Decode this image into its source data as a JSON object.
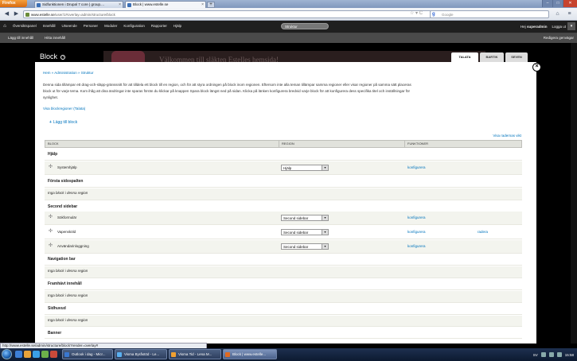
{
  "browser": {
    "app_button": "Firefox",
    "tabs": [
      {
        "label": "Sidfunktionen i Drupal 7 core | group....",
        "active": false
      },
      {
        "label": "Block | www.estelle.se",
        "active": true
      }
    ],
    "new_tab": "+",
    "url_prefix": "www.estelle.se",
    "url_rest": "/user/1#overlay=admin/structure/block",
    "search_engine": "Google",
    "search_placeholder": "Google",
    "status_url": "http://www.estelle.se/admin/structure/block?render=overlay#"
  },
  "toolbar": {
    "items": [
      "Översiktspanel",
      "Innehåll",
      "Struktur",
      "Utseende",
      "Personer",
      "Moduler",
      "Konfiguration",
      "Rapporter",
      "Hjälp"
    ],
    "selected": "Struktur",
    "greeting_prefix": "Hej",
    "username": "superadmin",
    "logout": "Logga ut",
    "shortcuts": [
      "Lägg till innehåll",
      "Hitta innehåll"
    ],
    "edit_shortcuts": "Redigera genvägar"
  },
  "background_site": {
    "welcome": "Välkommen till släkten Estelles hemsida!"
  },
  "overlay": {
    "title": "Block",
    "theme_tabs": [
      "TALATA",
      "BARTIK",
      "SEVEN"
    ],
    "active_theme": "TALATA",
    "breadcrumb": "Hem » Administration » Struktur",
    "description_1": "Denna sida tillämpar ett drag-och-släpp-gränssnitt för att tilldela ett block till en region, och för att styra ordningen på block inom regionen. Eftersom inte alla teman tillämpar samma regioner eller visar regioner på samma sätt placeras",
    "description_2": "block ut för varje tema. Kom ihåg att dina ändringar inte sparas förrän du klickar på knappen Spara block längst ned på sidan. Klicka på länken konfigurera bredvid varje block för att konfigurera dess specifika titel och inställningar för",
    "description_3": "synlighet.",
    "show_regions": "Visa blockregioner (Talata)",
    "add_block": "Lägg till block",
    "show_weights": "Visa radernas vikt",
    "columns": {
      "block": "BLOCK",
      "region": "REGION",
      "functions": "FUNKTIONER"
    },
    "regions": [
      {
        "name": "Hjälp",
        "blocks": [
          {
            "name": "Systemhjälp",
            "region": "Hjälp",
            "configure": "konfigurera"
          }
        ]
      },
      {
        "name": "Första sidospalten",
        "empty": "Inga block i denna region"
      },
      {
        "name": "Second sidebar",
        "blocks": [
          {
            "name": "Sökformulär",
            "region": "Second sidebar",
            "configure": "konfigurera"
          },
          {
            "name": "Vapensköld",
            "region": "Second sidebar",
            "configure": "konfigurera",
            "delete": "radera"
          },
          {
            "name": "Användarinloggning",
            "region": "Second sidebar",
            "configure": "konfigurera"
          }
        ]
      },
      {
        "name": "Navigation bar",
        "empty": "Inga block i denna region"
      },
      {
        "name": "Framhävt innehåll",
        "empty": "Inga block i denna region"
      },
      {
        "name": "Sidhuvud",
        "empty": "Inga block i denna region"
      },
      {
        "name": "Banner"
      }
    ]
  },
  "taskbar": {
    "tasks": [
      "Outlook i dag - Micr...",
      "Visma Byråstöd - Le...",
      "Visma Tid - Lena M...",
      "Block | www.estelle..."
    ],
    "active_task": "Block | www.estelle...",
    "language": "SV",
    "clock": "15:58"
  },
  "colors": {
    "link": "#0074bd",
    "toolbar_bg": "#1f1f1f",
    "header_bg": "#e1e2dc"
  }
}
